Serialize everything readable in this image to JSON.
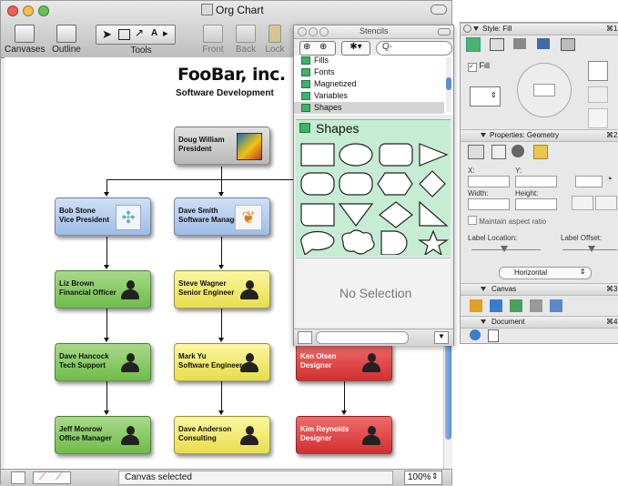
{
  "window": {
    "title": "Org Chart",
    "toolbar": {
      "canvases_label": "Canvases",
      "outline_label": "Outline",
      "tools_label": "Tools",
      "front_label": "Front",
      "back_label": "Back",
      "lock_label": "Lock"
    }
  },
  "document": {
    "company": "FooBar, inc.",
    "department": "Software Development"
  },
  "nodes": [
    {
      "name": "Doug William",
      "role": "President"
    },
    {
      "name": "Bob Stone",
      "role": "Vice President"
    },
    {
      "name": "Dave Smith",
      "role": "Software Manager"
    },
    {
      "name": "Liz Brown",
      "role": "Financial Officer"
    },
    {
      "name": "Steve Wagner",
      "role": "Senior Engineer"
    },
    {
      "name": "Dave Hancock",
      "role": "Tech Support"
    },
    {
      "name": "Mark Yu",
      "role": "Software Engineer"
    },
    {
      "name": "Ken Olsen",
      "role": "Designer"
    },
    {
      "name": "Jeff Monrow",
      "role": "Office Manager"
    },
    {
      "name": "Dave Anderson",
      "role": "Consulting"
    },
    {
      "name": "Kim Reynolds",
      "role": "Designer"
    }
  ],
  "status": {
    "text": "Canvas selected",
    "zoom": "100%"
  },
  "stencils": {
    "title": "Stencils",
    "search_placeholder": "Q-",
    "items": [
      "Fills",
      "Fonts",
      "Magnetized",
      "Variables",
      "Shapes"
    ],
    "group_title": "Shapes",
    "selection_text": "No Selection"
  },
  "inspector": {
    "style_header": "Style: Fill",
    "fill_label": "Fill",
    "geometry_header": "Properties: Geometry",
    "x_label": "X:",
    "y_label": "Y:",
    "width_label": "Width:",
    "height_label": "Height:",
    "aspect_label": "Maintain aspect ratio",
    "label_location": "Label Location:",
    "label_offset": "Label Offset:",
    "orientation": "Horizontal",
    "canvas_header": "Canvas",
    "document_header": "Document",
    "shortcut_1": "⌘1",
    "shortcut_2": "⌘2",
    "shortcut_3": "⌘3",
    "shortcut_4": "⌘4"
  }
}
